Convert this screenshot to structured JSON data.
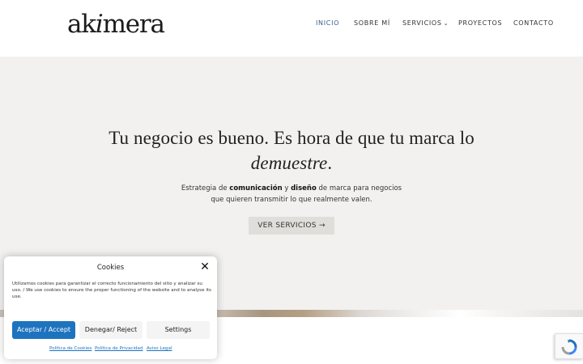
{
  "header": {
    "logo": {
      "part1": "ak",
      "part2": "i",
      "part3": "mera"
    },
    "nav": [
      {
        "label": "INICIO",
        "active": true
      },
      {
        "label": "SOBRE MÍ"
      },
      {
        "label": "SERVICIOS",
        "dropdown": true
      },
      {
        "label": "PROYECTOS"
      },
      {
        "label": "CONTACTO"
      }
    ],
    "chevron_icon": "chevron-down-icon"
  },
  "hero": {
    "title_line1": "Tu negocio es bueno. Es hora de que tu marca lo",
    "title_em": "demuestre",
    "title_end": ".",
    "subtitle": {
      "t1": "Estrategia de ",
      "b1": "comunicación",
      "t2": " y ",
      "b2": "diseño",
      "t3": " de marca para negocios",
      "t4": "que quieren transmitir lo que realmente valen."
    },
    "cta_label": "VER SERVICIOS",
    "cta_icon": "arrow-right-icon"
  },
  "cookie": {
    "title": "Cookies",
    "close_icon": "close-icon",
    "text": "Utilizamos cookies para garantizar el correcto funcionamiento del sitio y analizar su uso. / We use cookies to ensure the proper functioning of the website and to analyse its use.",
    "accept_label": "Aceptar / Accept",
    "deny_label": "Denegar/ Reject",
    "settings_label": "Settings",
    "links": [
      "Política de Cookies",
      "Política de Privacidad",
      "Aviso Legal"
    ]
  },
  "recaptcha": {
    "icon": "recaptcha-icon"
  },
  "colors": {
    "accent": "#1e73be",
    "nav_active": "#3b5a8a",
    "hero_bg": "#f2f1f0",
    "cta_bg": "#e0deda"
  }
}
